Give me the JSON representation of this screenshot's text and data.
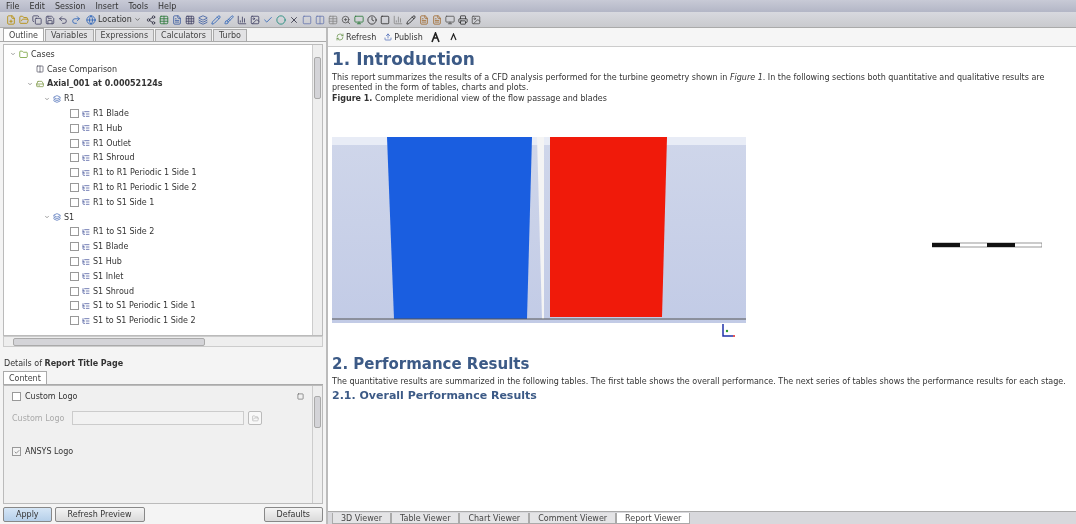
{
  "menu": [
    "File",
    "Edit",
    "Session",
    "Insert",
    "Tools",
    "Help"
  ],
  "toolbar": {
    "location": "Location"
  },
  "left_tabs": [
    {
      "label": "Outline",
      "selected": true
    },
    {
      "label": "Variables",
      "selected": false
    },
    {
      "label": "Expressions",
      "selected": false
    },
    {
      "label": "Calculators",
      "selected": false
    },
    {
      "label": "Turbo",
      "selected": false
    }
  ],
  "tree": [
    {
      "label": "Cases",
      "kind": "folder",
      "expanded": true,
      "children": [
        {
          "label": "Case Comparison",
          "kind": "compare"
        },
        {
          "label": "Axial_001 at 0.00052124s",
          "kind": "case",
          "bold": true,
          "expanded": true,
          "children": [
            {
              "label": "R1",
              "kind": "domain",
              "expanded": true,
              "children": [
                {
                  "label": "R1 Blade",
                  "kind": "boundary",
                  "checked": false
                },
                {
                  "label": "R1 Hub",
                  "kind": "boundary",
                  "checked": false
                },
                {
                  "label": "R1 Outlet",
                  "kind": "boundary",
                  "checked": false
                },
                {
                  "label": "R1 Shroud",
                  "kind": "boundary",
                  "checked": false
                },
                {
                  "label": "R1 to R1 Periodic 1 Side 1",
                  "kind": "boundary",
                  "checked": false
                },
                {
                  "label": "R1 to R1 Periodic 1 Side 2",
                  "kind": "boundary",
                  "checked": false
                },
                {
                  "label": "R1 to S1 Side 1",
                  "kind": "boundary",
                  "checked": false
                }
              ]
            },
            {
              "label": "S1",
              "kind": "domain",
              "expanded": true,
              "children": [
                {
                  "label": "R1 to S1 Side 2",
                  "kind": "boundary",
                  "checked": false
                },
                {
                  "label": "S1 Blade",
                  "kind": "boundary",
                  "checked": false
                },
                {
                  "label": "S1 Hub",
                  "kind": "boundary",
                  "checked": false
                },
                {
                  "label": "S1 Inlet",
                  "kind": "boundary",
                  "checked": false
                },
                {
                  "label": "S1 Shroud",
                  "kind": "boundary",
                  "checked": false
                },
                {
                  "label": "S1 to S1 Periodic 1 Side 1",
                  "kind": "boundary",
                  "checked": false
                },
                {
                  "label": "S1 to S1 Periodic 1 Side 2",
                  "kind": "boundary",
                  "checked": false
                }
              ]
            }
          ]
        }
      ]
    }
  ],
  "details": {
    "title": "Details of **Report Title Page**",
    "tabs": [
      {
        "label": "Content",
        "selected": true
      }
    ],
    "custom_logo": {
      "label": "Custom Logo",
      "checked": false
    },
    "custom_logo_field": {
      "label": "Custom Logo",
      "disabled": true
    },
    "ansys_logo": {
      "label": "ANSYS Logo",
      "checked": true
    }
  },
  "buttons": [
    "Apply",
    "Refresh Preview",
    "Defaults"
  ],
  "report_toolbar": [
    "Refresh",
    "Publish"
  ],
  "report": {
    "heading1": "1. Introduction",
    "intro": "This report summarizes the results of a CFD analysis performed for the turbine geometry shown in *Figure 1*. In the following sections both quantitative and qualitative results are presented in the form of tables, charts and plots.",
    "caption": "**Figure 1.** Complete meridional view of the flow passage and blades",
    "heading2": "2. Performance Results",
    "perf": "The quantitative results are summarized in the following tables. The first table shows the overall performance. The next series of tables shows the performance results for each stage.",
    "heading3": "2.1. Overall Performance Results"
  },
  "viewer_tabs": [
    {
      "label": "3D Viewer",
      "selected": false
    },
    {
      "label": "Table Viewer",
      "selected": false
    },
    {
      "label": "Chart Viewer",
      "selected": false
    },
    {
      "label": "Comment Viewer",
      "selected": false
    },
    {
      "label": "Report Viewer",
      "selected": true
    }
  ]
}
